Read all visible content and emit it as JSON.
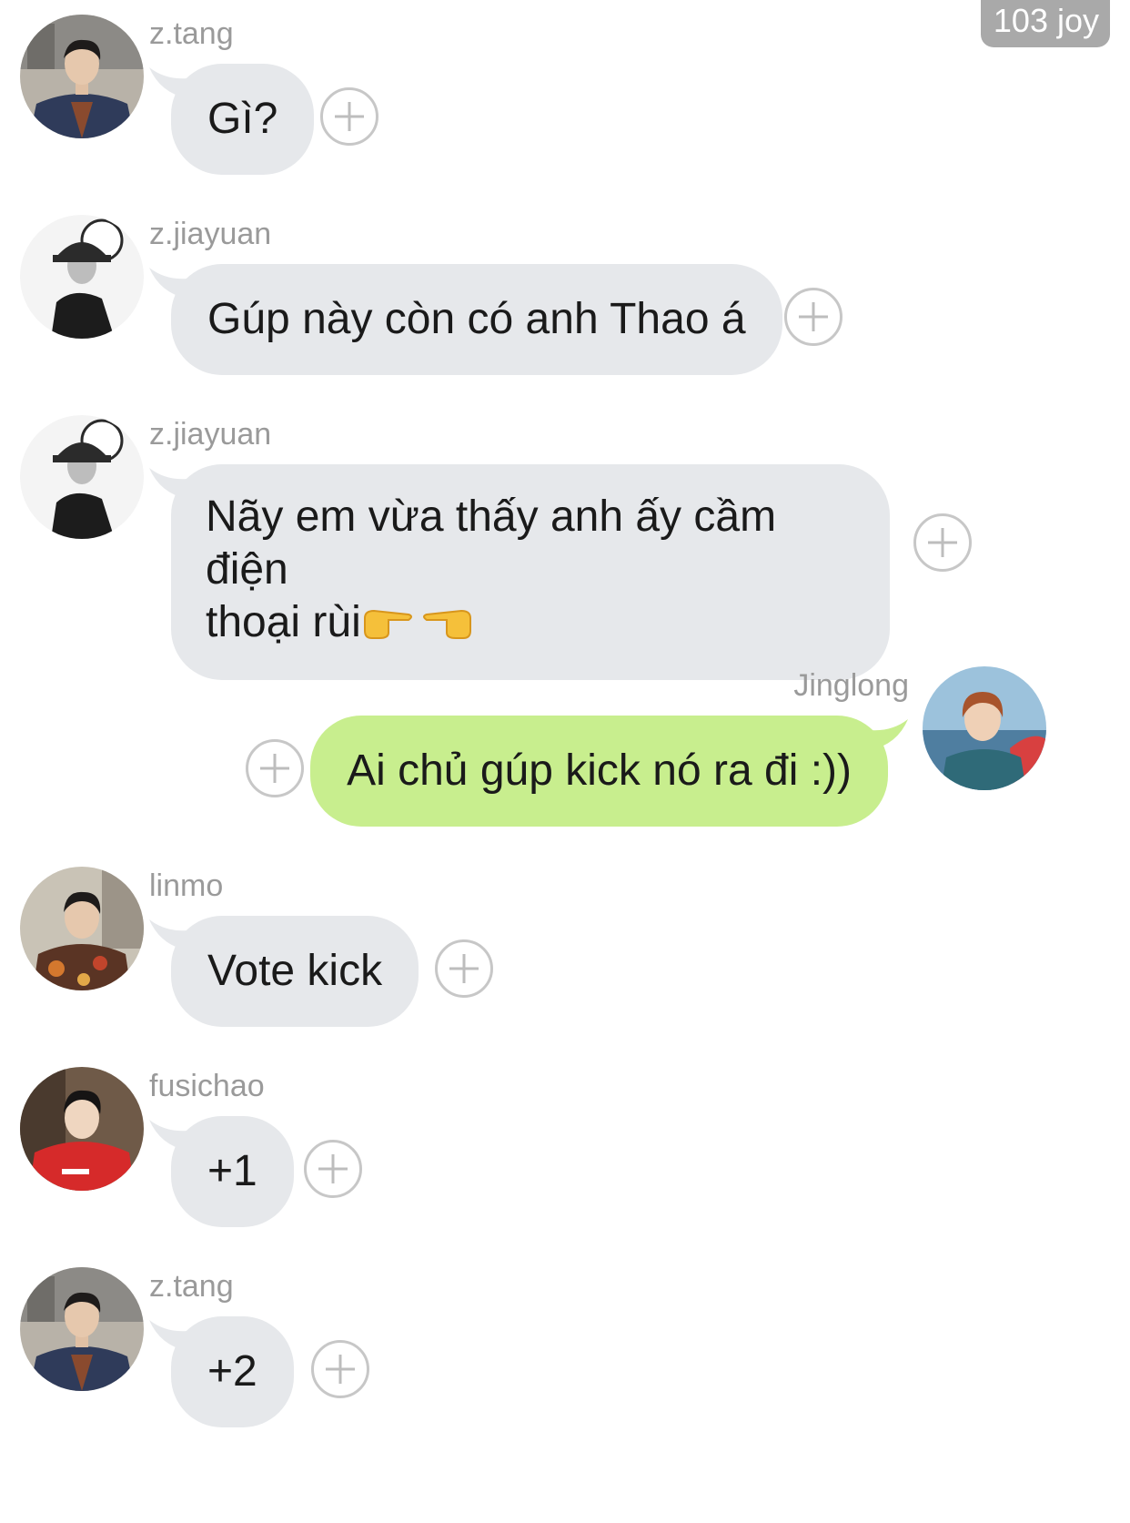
{
  "watermark": "103 joy",
  "messages": [
    {
      "id": "m1",
      "sender": "z.tang",
      "text": "Gì?",
      "direction": "incoming",
      "avatar_icon": "user-photo-icon"
    },
    {
      "id": "m2",
      "sender": "z.jiayuan",
      "text": "Gúp này còn có anh Thao á",
      "direction": "incoming",
      "avatar_icon": "user-photo-icon"
    },
    {
      "id": "m3",
      "sender": "z.jiayuan",
      "text_line1": "Nãy em vừa thấy anh ấy cầm điện",
      "text_line2": "thoại rùi",
      "emoji": [
        "pointing-right-emoji",
        "pointing-left-emoji"
      ],
      "direction": "incoming",
      "avatar_icon": "user-photo-icon"
    },
    {
      "id": "m4",
      "sender": "Jinglong",
      "text": "Ai chủ gúp kick nó ra đi :))",
      "direction": "outgoing",
      "avatar_icon": "user-photo-icon"
    },
    {
      "id": "m5",
      "sender": "linmo",
      "text": "Vote kick",
      "direction": "incoming",
      "avatar_icon": "user-photo-icon"
    },
    {
      "id": "m6",
      "sender": "fusichao",
      "text": "+1",
      "direction": "incoming",
      "avatar_icon": "user-photo-icon"
    },
    {
      "id": "m7",
      "sender": "z.tang",
      "text": "+2",
      "direction": "incoming",
      "avatar_icon": "user-photo-icon"
    }
  ],
  "colors": {
    "incoming_bubble": "#e6e8eb",
    "outgoing_bubble": "#c8ee8e",
    "sender_name": "#9a9a9a",
    "react_icon": "#c7c7c7"
  }
}
